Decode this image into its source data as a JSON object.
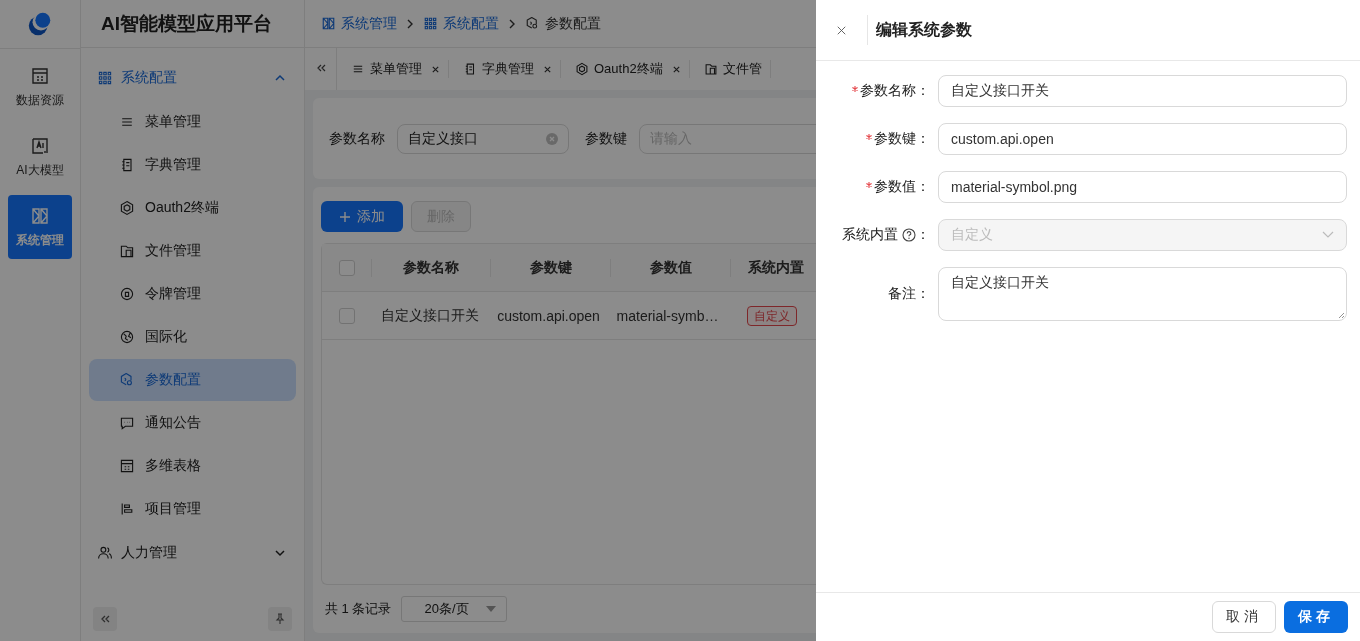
{
  "app": {
    "title": "AI智能模型应用平台"
  },
  "rail": [
    {
      "label": "数据资源",
      "selected": false
    },
    {
      "label": "AI大模型",
      "selected": false
    },
    {
      "label": "系统管理",
      "selected": true
    }
  ],
  "menu": [
    {
      "label": "系统配置",
      "expanded": true,
      "children": [
        {
          "label": "菜单管理",
          "selected": false
        },
        {
          "label": "字典管理",
          "selected": false
        },
        {
          "label": "Oauth2终端",
          "selected": false
        },
        {
          "label": "文件管理",
          "selected": false
        },
        {
          "label": "令牌管理",
          "selected": false
        },
        {
          "label": "国际化",
          "selected": false
        },
        {
          "label": "参数配置",
          "selected": true
        },
        {
          "label": "通知公告",
          "selected": false
        },
        {
          "label": "多维表格",
          "selected": false
        },
        {
          "label": "项目管理",
          "selected": false
        }
      ]
    },
    {
      "label": "人力管理",
      "expanded": false
    }
  ],
  "breadcrumb": [
    "系统管理",
    "系统配置",
    "参数配置"
  ],
  "tabs": [
    {
      "label": "菜单管理",
      "closable": true
    },
    {
      "label": "字典管理",
      "closable": true
    },
    {
      "label": "Oauth2终端",
      "closable": true
    },
    {
      "label": "文件管",
      "closable": false
    }
  ],
  "filters": [
    {
      "label": "参数名称",
      "value": "自定义接口"
    },
    {
      "label": "参数键",
      "placeholder": "请输入"
    }
  ],
  "buttons": [
    {
      "label": "添加",
      "kind": "primary",
      "disabled": false
    },
    {
      "label": "删除",
      "kind": "default",
      "disabled": true
    }
  ],
  "table": {
    "all_checked": false,
    "columns": [
      "参数名称",
      "参数键",
      "参数值",
      "系统内置"
    ],
    "rows": [
      {
        "checked": false,
        "cells": [
          "自定义接口开关",
          "custom.api.open",
          "material-symb…"
        ],
        "tag": {
          "label": "自定义"
        }
      }
    ]
  },
  "pagination": {
    "total": "共 1 条记录",
    "page_size": "20条/页"
  },
  "drawer": {
    "title": "编辑系统参数",
    "fields": [
      {
        "label": "参数名称：",
        "kind": "input",
        "required": true,
        "value": "自定义接口开关"
      },
      {
        "label": "参数键：",
        "kind": "input",
        "required": true,
        "value": "custom.api.open"
      },
      {
        "label": "参数值：",
        "kind": "input",
        "required": true,
        "value": "material-symbol.png"
      },
      {
        "label": "系统内置",
        "label_end": "：",
        "kind": "select",
        "required": false,
        "help": true,
        "disabled": true,
        "value": "自定义"
      },
      {
        "label": "备注：",
        "kind": "textarea",
        "required": false,
        "value": "自定义接口开关"
      }
    ],
    "buttons": [
      {
        "label": "取消",
        "kind": "default"
      },
      {
        "label": "保存",
        "kind": "primary"
      }
    ]
  }
}
